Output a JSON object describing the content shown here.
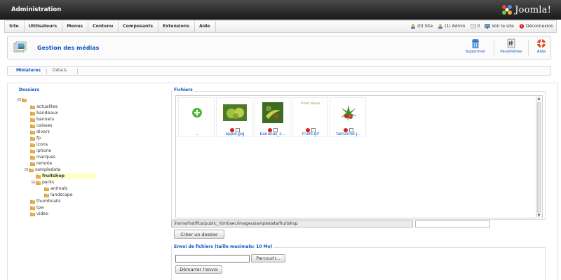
{
  "header": {
    "title": "Administration",
    "logo_text": "Joomla!"
  },
  "menu": {
    "items": [
      "Site",
      "Utilisateurs",
      "Menus",
      "Contenu",
      "Composants",
      "Extensions",
      "Aide"
    ]
  },
  "status": {
    "site": "(0) Site",
    "admin": "(1) Admin",
    "messages": "0",
    "view_site": "Voir le site",
    "logout": "Déconnexion"
  },
  "toolbar": {
    "page_title": "Gestion des médias",
    "delete_label": "Supprimer",
    "params_label": "Paramètres",
    "help_label": "Aide"
  },
  "tabs": {
    "thumbnails": "Miniatures",
    "details": "Détails"
  },
  "folders": {
    "legend": "Dossiers",
    "items": [
      "actualites",
      "bandeaux",
      "banners",
      "caisses",
      "divers",
      "fp",
      "icons",
      "iphone",
      "marques",
      "remote",
      "sampledata",
      "fruitshop",
      "parks",
      "animals",
      "landscape",
      "thumbnails",
      "tpa",
      "video"
    ],
    "toggle_collapse": "⊟",
    "toggle_expand": "⊞"
  },
  "files": {
    "legend": "Fichiers",
    "up_label": "..",
    "items": [
      {
        "name": "apple.jpg"
      },
      {
        "name": "bananas_2..."
      },
      {
        "name": "fruits.gif",
        "caption": "Fruit Shop"
      },
      {
        "name": "tamarind.j..."
      }
    ]
  },
  "path": {
    "value": "/home/fxdiffus/public_html/aec/images/sampledata/fruitshop"
  },
  "create_folder_button": "Créer un dossier",
  "upload": {
    "legend": "Envoi de fichiers (taille maximale: 10 Mo)",
    "browse_button": "Parcourir...",
    "start_button": "Démarrer l'envoi"
  },
  "colors": {
    "accent": "#0b55c4",
    "header_dark": "#1b1b1b",
    "joomla_orange": "#f9a541"
  }
}
